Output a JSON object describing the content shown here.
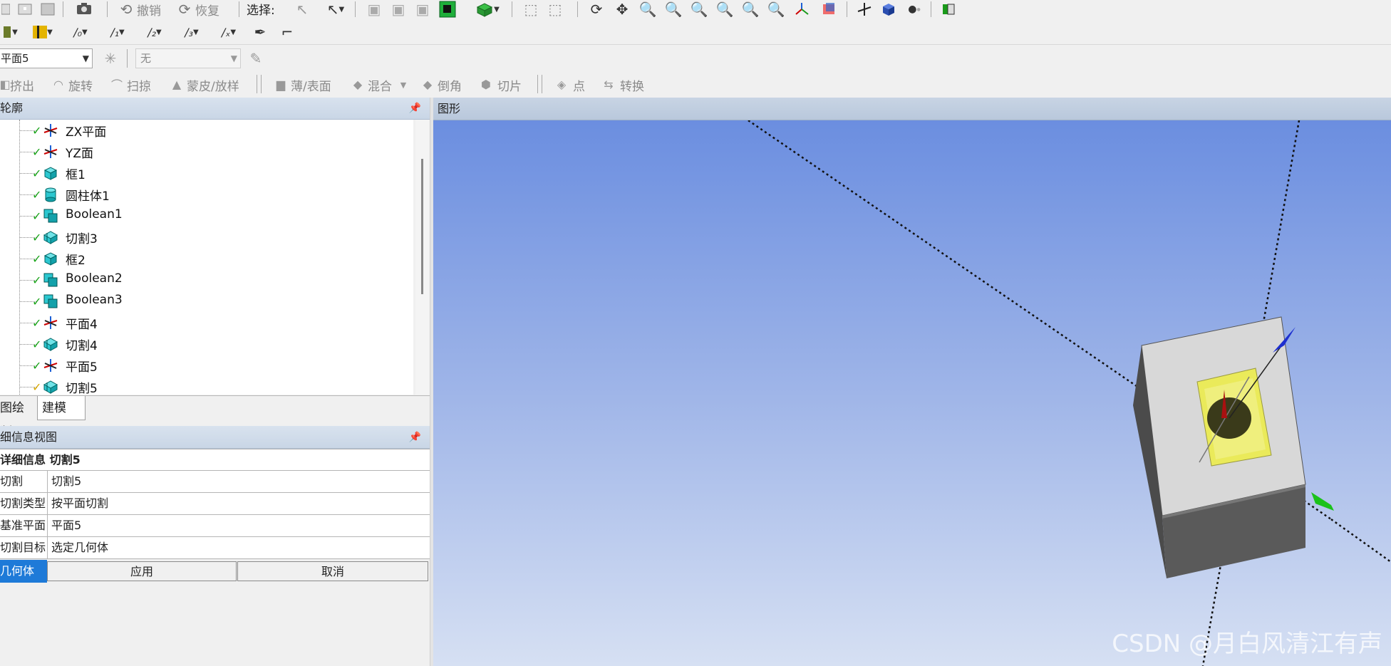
{
  "toolbar1": {
    "undo_label": "撤销",
    "redo_label": "恢复",
    "select_label": "选择:"
  },
  "toolbar3": {
    "plane_select": "平面5",
    "none_select": "无"
  },
  "toolbar4": {
    "extrude": "挤出",
    "revolve": "旋转",
    "sweep": "扫掠",
    "skin_loft": "蒙皮/放样",
    "thin_surface": "薄/表面",
    "blend": "混合",
    "chamfer": "倒角",
    "slice": "切片",
    "point": "点",
    "convert": "转换"
  },
  "outline": {
    "title": "轮廓",
    "items": [
      {
        "label": "ZX平面",
        "icon": "plane-icon"
      },
      {
        "label": "YZ面",
        "icon": "plane-icon"
      },
      {
        "label": "框1",
        "icon": "box-icon"
      },
      {
        "label": "圆柱体1",
        "icon": "cylinder-icon"
      },
      {
        "label": "Boolean1",
        "icon": "boolean-icon"
      },
      {
        "label": "切割3",
        "icon": "slice-icon"
      },
      {
        "label": "框2",
        "icon": "box-icon"
      },
      {
        "label": "Boolean2",
        "icon": "boolean-icon"
      },
      {
        "label": "Boolean3",
        "icon": "boolean-icon"
      },
      {
        "label": "平面4",
        "icon": "plane-icon"
      },
      {
        "label": "切割4",
        "icon": "slice-icon"
      },
      {
        "label": "平面5",
        "icon": "plane-icon"
      },
      {
        "label": "切割5",
        "icon": "slice-icon"
      }
    ]
  },
  "tabs": {
    "sketching": "图绘制",
    "modeling": "建模"
  },
  "details": {
    "panel_title": "细信息视图",
    "header": "详细信息 切割5",
    "rows": [
      {
        "key": "切割",
        "value": "切割5"
      },
      {
        "key": "切割类型",
        "value": "按平面切割"
      },
      {
        "key": "基准平面",
        "value": "平面5"
      },
      {
        "key": "切割目标",
        "value": "选定几何体"
      }
    ],
    "geometry_label": "几何体",
    "apply": "应用",
    "cancel": "取消"
  },
  "graphics": {
    "title": "图形"
  },
  "watermark": "CSDN @月白风清江有声",
  "colors": {
    "viewport_top": "#6b8ee0",
    "viewport_bottom": "#d6e0f3",
    "selection": "#1e7ad8",
    "check": "#1aa51a",
    "cyan_icon": "#2cc7d0"
  }
}
